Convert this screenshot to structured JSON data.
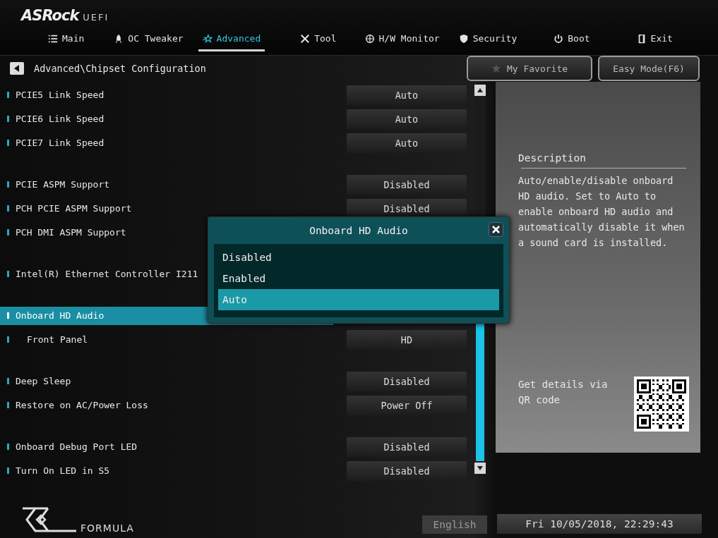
{
  "logo": {
    "brand": "ASRock",
    "suffix": "UEFI"
  },
  "tabs": [
    {
      "label": "Main",
      "selected": false
    },
    {
      "label": "OC Tweaker",
      "selected": false
    },
    {
      "label": "Advanced",
      "selected": true
    },
    {
      "label": "Tool",
      "selected": false
    },
    {
      "label": "H/W Monitor",
      "selected": false
    },
    {
      "label": "Security",
      "selected": false
    },
    {
      "label": "Boot",
      "selected": false
    },
    {
      "label": "Exit",
      "selected": false
    }
  ],
  "breadcrumb": "Advanced\\Chipset Configuration",
  "buttons": [
    "My Favorite",
    "Easy Mode(F6)"
  ],
  "groups": [
    [
      {
        "label": "PCIE5 Link Speed",
        "value": "Auto",
        "selected": false
      },
      {
        "label": "PCIE6 Link Speed",
        "value": "Auto",
        "selected": false
      },
      {
        "label": "PCIE7 Link Speed",
        "value": "Auto",
        "selected": false
      }
    ],
    [
      {
        "label": "PCIE ASPM Support",
        "value": "Disabled",
        "selected": false
      },
      {
        "label": "PCH PCIE ASPM Support",
        "value": "Disabled",
        "selected": false
      },
      {
        "label": "PCH DMI ASPM Support",
        "selected": false
      }
    ],
    [
      {
        "label": "Intel(R) Ethernet Controller I211",
        "selected": false
      }
    ],
    [
      {
        "label": "Onboard HD Audio",
        "selected": true,
        "children": [
          {
            "label": "Front Panel",
            "value": "HD",
            "selected": false
          }
        ]
      }
    ],
    [
      {
        "label": "Deep Sleep",
        "value": "Disabled",
        "selected": false
      },
      {
        "label": "Restore on AC/Power Loss",
        "value": "Power Off",
        "selected": false
      }
    ],
    [
      {
        "label": "Onboard Debug Port LED",
        "value": "Disabled",
        "selected": false
      },
      {
        "label": "Turn On LED in S5",
        "value": "Disabled",
        "selected": false
      }
    ]
  ],
  "description": {
    "title": "Description",
    "text": "Auto/enable/disable onboard HD audio. Set to Auto to enable onboard HD audio and automatically disable it when a sound card is installed.",
    "qr_text": "Get details via QR code"
  },
  "dialog": {
    "title": "Onboard HD Audio",
    "options": [
      {
        "label": "Disabled",
        "selected": false
      },
      {
        "label": "Enabled",
        "selected": false
      },
      {
        "label": "Auto",
        "selected": true
      }
    ]
  },
  "footer": {
    "logo_text": "FORMULA",
    "language": "English",
    "datetime": "Fri 10/05/2018, 22:29:43"
  }
}
